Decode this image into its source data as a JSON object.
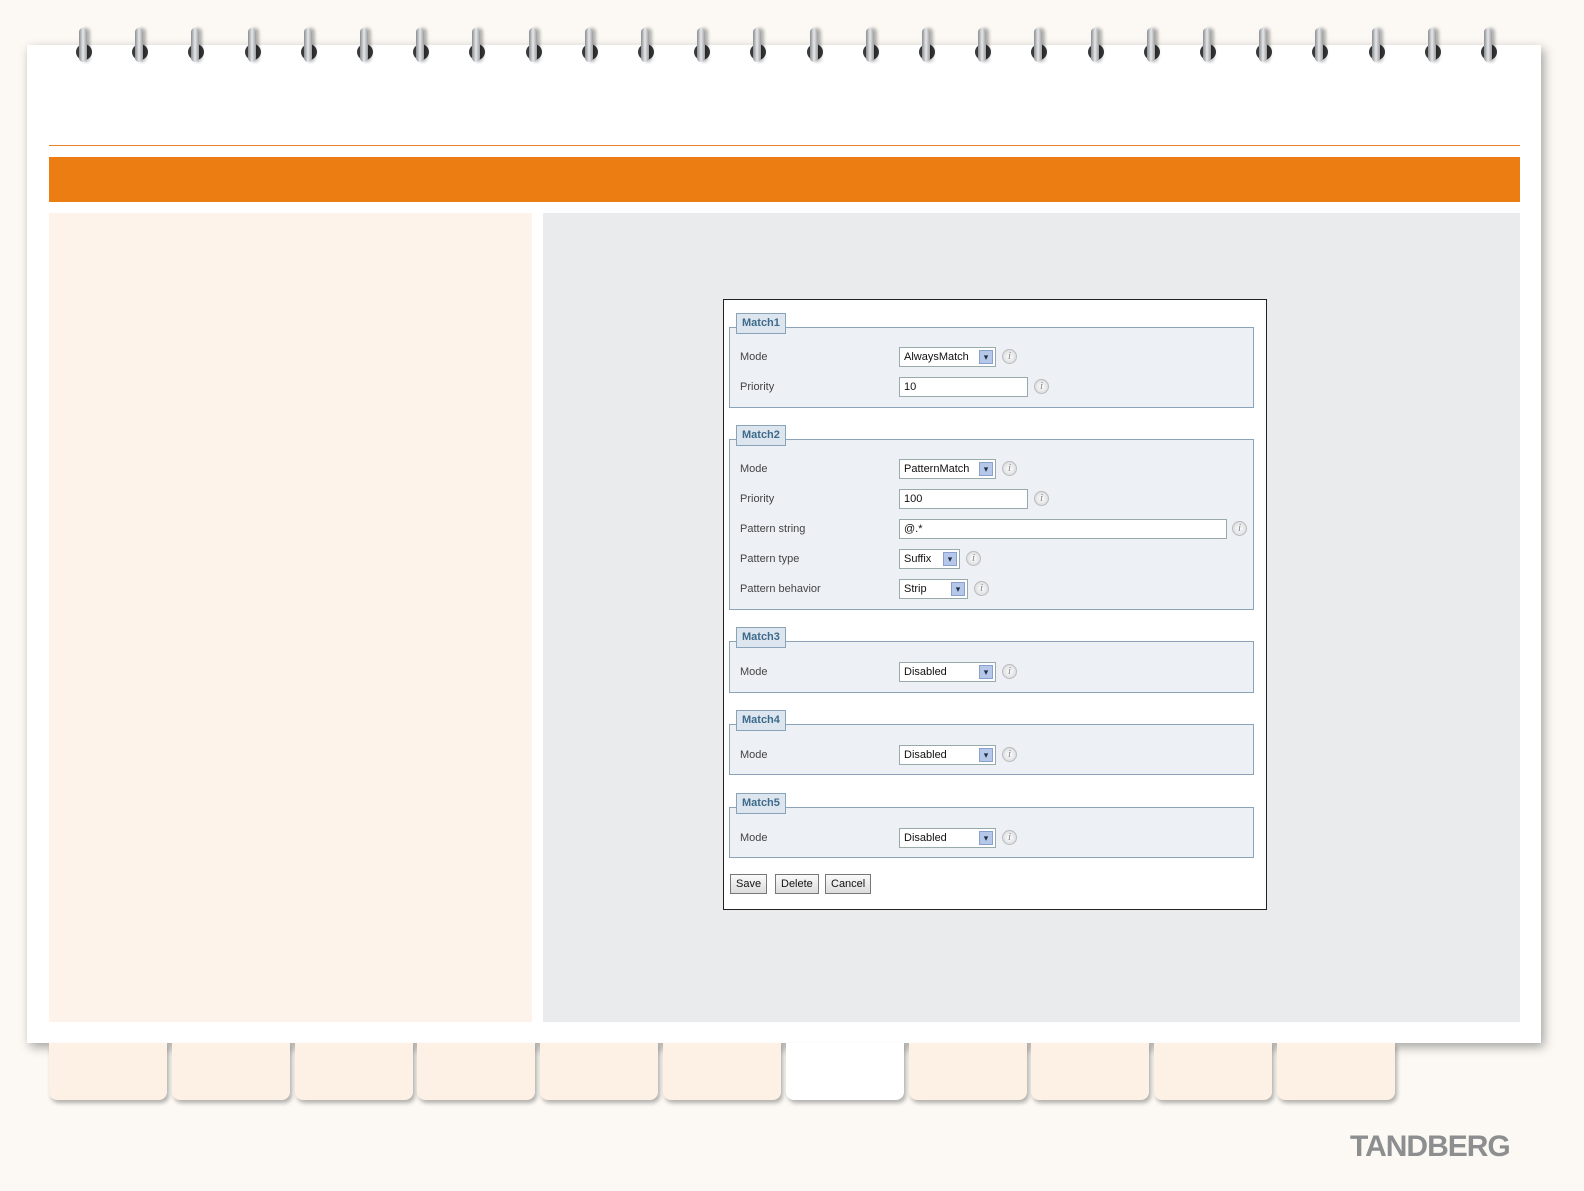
{
  "brand": {
    "logo": "TANDBERG"
  },
  "form": {
    "match1": {
      "legend": "Match1",
      "mode_label": "Mode",
      "mode": "AlwaysMatch",
      "priority_label": "Priority",
      "priority": "10"
    },
    "match2": {
      "legend": "Match2",
      "mode_label": "Mode",
      "mode": "PatternMatch",
      "priority_label": "Priority",
      "priority": "100",
      "pattern_string_label": "Pattern string",
      "pattern_string": "@.*",
      "pattern_type_label": "Pattern type",
      "pattern_type": "Suffix",
      "pattern_behavior_label": "Pattern behavior",
      "pattern_behavior": "Strip"
    },
    "match3": {
      "legend": "Match3",
      "mode_label": "Mode",
      "mode": "Disabled"
    },
    "match4": {
      "legend": "Match4",
      "mode_label": "Mode",
      "mode": "Disabled"
    },
    "match5": {
      "legend": "Match5",
      "mode_label": "Mode",
      "mode": "Disabled"
    },
    "info_glyph": "i",
    "arrow_glyph": "▾",
    "buttons": {
      "save": "Save",
      "delete": "Delete",
      "cancel": "Cancel"
    }
  },
  "colors": {
    "accent": "#ec7d13",
    "legend_text": "#3e6a8c"
  }
}
